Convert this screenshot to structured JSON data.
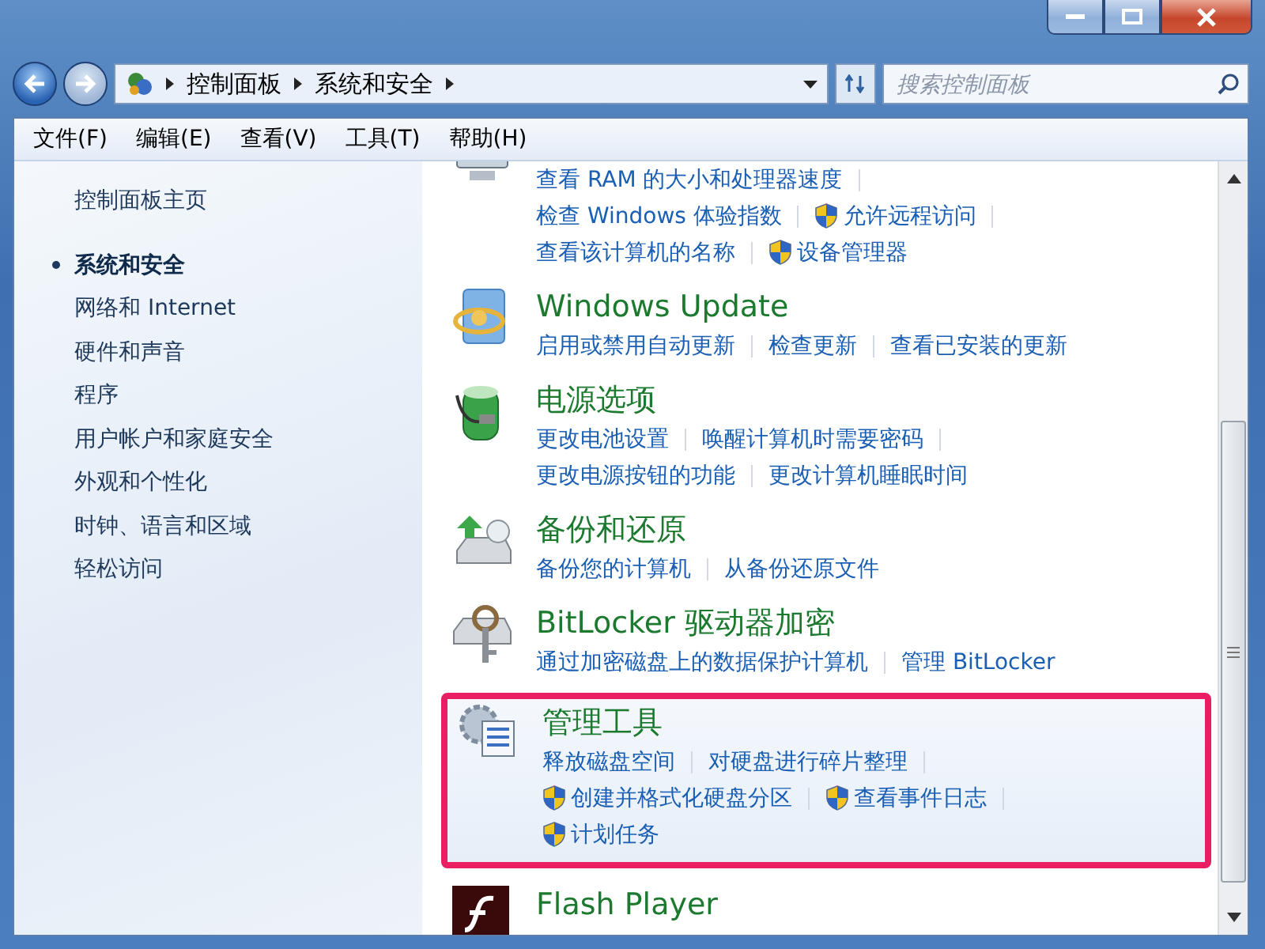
{
  "address_bar": {
    "breadcrumb": [
      "控制面板",
      "系统和安全"
    ],
    "search": {
      "placeholder": "搜索控制面板"
    }
  },
  "menu_bar": [
    "文件(F)",
    "编辑(E)",
    "查看(V)",
    "工具(T)",
    "帮助(H)"
  ],
  "sidebar": {
    "home": "控制面板主页",
    "items": [
      {
        "label": "系统和安全",
        "selected": true
      },
      {
        "label": "网络和 Internet",
        "selected": false
      },
      {
        "label": "硬件和声音",
        "selected": false
      },
      {
        "label": "程序",
        "selected": false
      },
      {
        "label": "用户帐户和家庭安全",
        "selected": false
      },
      {
        "label": "外观和个性化",
        "selected": false
      },
      {
        "label": "时钟、语言和区域",
        "selected": false
      },
      {
        "label": "轻松访问",
        "selected": false
      }
    ]
  },
  "sections": [
    {
      "highlighted": false,
      "lines": [
        [
          {
            "text": "查看 RAM 的大小和处理器速度",
            "shield": false
          }
        ],
        [
          {
            "text": "检查 Windows 体验指数",
            "shield": false
          },
          {
            "text": "允许远程访问",
            "shield": true
          }
        ],
        [
          {
            "text": "查看该计算机的名称",
            "shield": false
          },
          {
            "text": "设备管理器",
            "shield": true
          }
        ]
      ]
    },
    {
      "title": "Windows Update",
      "highlighted": false,
      "lines": [
        [
          {
            "text": "启用或禁用自动更新",
            "shield": false
          },
          {
            "text": "检查更新",
            "shield": false
          },
          {
            "text": "查看已安装的更新",
            "shield": false
          }
        ]
      ]
    },
    {
      "title": "电源选项",
      "highlighted": false,
      "lines": [
        [
          {
            "text": "更改电池设置",
            "shield": false
          },
          {
            "text": "唤醒计算机时需要密码",
            "shield": false
          }
        ],
        [
          {
            "text": "更改电源按钮的功能",
            "shield": false
          },
          {
            "text": "更改计算机睡眠时间",
            "shield": false
          }
        ]
      ]
    },
    {
      "title": "备份和还原",
      "highlighted": false,
      "lines": [
        [
          {
            "text": "备份您的计算机",
            "shield": false
          },
          {
            "text": "从备份还原文件",
            "shield": false
          }
        ]
      ]
    },
    {
      "title": "BitLocker 驱动器加密",
      "highlighted": false,
      "lines": [
        [
          {
            "text": "通过加密磁盘上的数据保护计算机",
            "shield": false
          },
          {
            "text": "管理 BitLocker",
            "shield": false
          }
        ]
      ]
    },
    {
      "title": "管理工具",
      "highlighted": true,
      "lines": [
        [
          {
            "text": "释放磁盘空间",
            "shield": false
          },
          {
            "text": "对硬盘进行碎片整理",
            "shield": false
          }
        ],
        [
          {
            "text": "创建并格式化硬盘分区",
            "shield": true
          },
          {
            "text": "查看事件日志",
            "shield": true
          }
        ],
        [
          {
            "text": "计划任务",
            "shield": true
          }
        ]
      ]
    },
    {
      "title": "Flash Player",
      "highlighted": false
    }
  ]
}
